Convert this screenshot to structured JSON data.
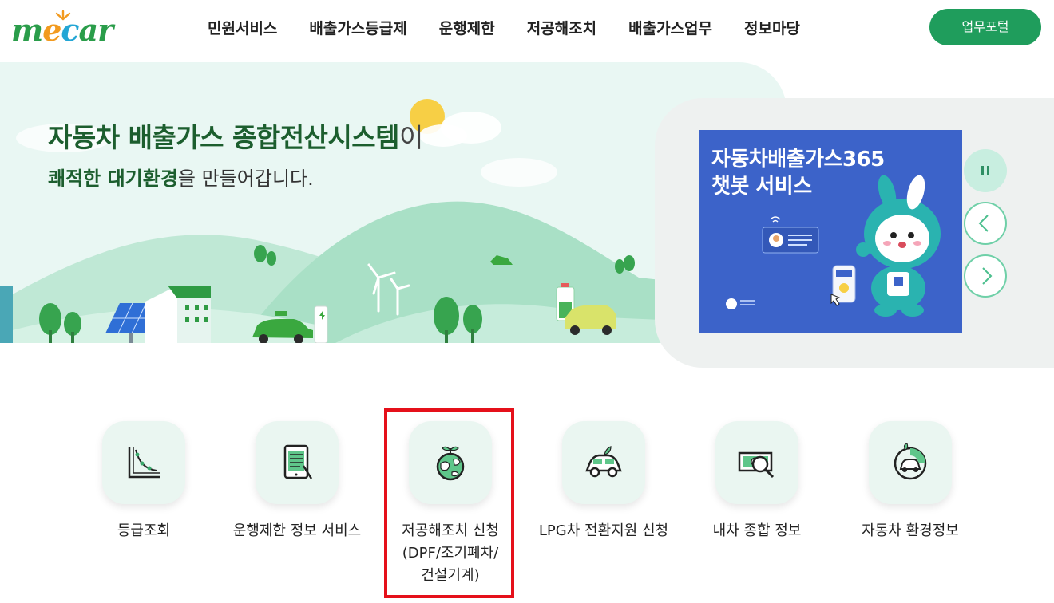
{
  "header": {
    "logo": {
      "letters": [
        "m",
        "e",
        "c",
        "a",
        "r"
      ]
    },
    "nav": [
      {
        "label": "민원서비스"
      },
      {
        "label": "배출가스등급제"
      },
      {
        "label": "운행제한"
      },
      {
        "label": "저공해조치"
      },
      {
        "label": "배출가스업무"
      },
      {
        "label": "정보마당"
      }
    ],
    "portal_button": "업무포털"
  },
  "hero": {
    "title_main": "자동차 배출가스 종합전산시스템",
    "title_suffix": "이",
    "subtitle_strong": "쾌적한 대기환경",
    "subtitle_rest": "을 만들어갑니다."
  },
  "slider": {
    "banner_title": "자동차배출가스365\n챗봇 서비스",
    "controls": {
      "pause_icon": "pause-icon",
      "prev_icon": "chevron-left-icon",
      "next_icon": "chevron-right-icon"
    }
  },
  "quick_services": [
    {
      "label": "등급조회",
      "icon": "graph-icon"
    },
    {
      "label": "운행제한 정보 서비스",
      "icon": "tablet-checklist-icon"
    },
    {
      "label": "저공해조치 신청\n(DPF/조기폐차/\n건설기계)",
      "icon": "earth-sprout-icon"
    },
    {
      "label": "LPG차 전환지원 신청",
      "icon": "eco-car-icon"
    },
    {
      "label": "내차 종합 정보",
      "icon": "money-search-icon"
    },
    {
      "label": "자동차 환경정보",
      "icon": "car-leaf-icon"
    }
  ],
  "colors": {
    "brand_green": "#1f9d5c",
    "hero_bg": "#e9f7f3",
    "banner_blue": "#3c63c9",
    "highlight_red": "#e5101a"
  }
}
